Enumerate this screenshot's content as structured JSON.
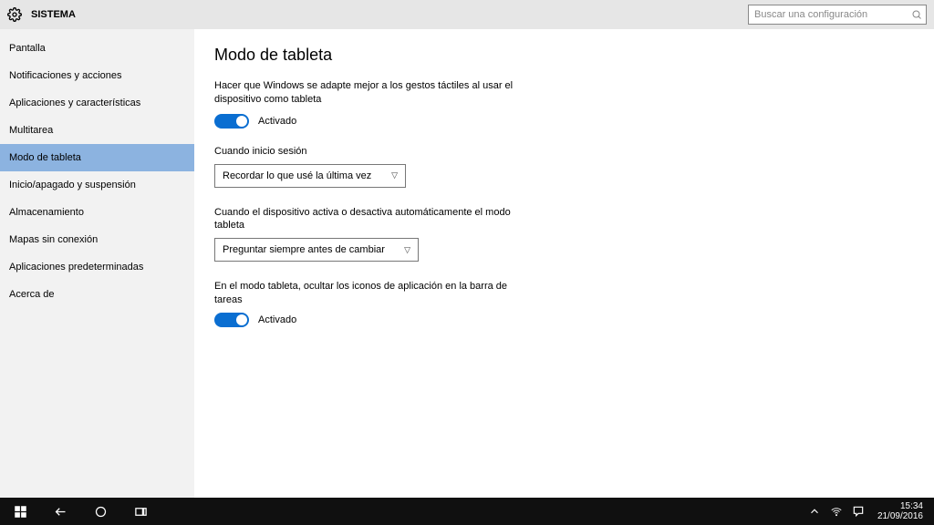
{
  "header": {
    "title": "SISTEMA",
    "search_placeholder": "Buscar una configuración"
  },
  "sidebar": {
    "items": [
      {
        "label": "Pantalla"
      },
      {
        "label": "Notificaciones y acciones"
      },
      {
        "label": "Aplicaciones y características"
      },
      {
        "label": "Multitarea"
      },
      {
        "label": "Modo de tableta"
      },
      {
        "label": "Inicio/apagado y suspensión"
      },
      {
        "label": "Almacenamiento"
      },
      {
        "label": "Mapas sin conexión"
      },
      {
        "label": "Aplicaciones predeterminadas"
      },
      {
        "label": "Acerca de"
      }
    ],
    "selected_index": 4
  },
  "content": {
    "title": "Modo de tableta",
    "setting1": {
      "desc": "Hacer que Windows se adapte mejor a los gestos táctiles al usar el dispositivo como tableta",
      "state": "Activado"
    },
    "setting2": {
      "label": "Cuando inicio sesión",
      "value": "Recordar lo que usé la última vez"
    },
    "setting3": {
      "label": "Cuando el dispositivo activa o desactiva automáticamente el modo tableta",
      "value": "Preguntar siempre antes de cambiar"
    },
    "setting4": {
      "desc": "En el modo tableta, ocultar los iconos de aplicación en la barra de tareas",
      "state": "Activado"
    }
  },
  "taskbar": {
    "time": "15:34",
    "date": "21/09/2016"
  }
}
